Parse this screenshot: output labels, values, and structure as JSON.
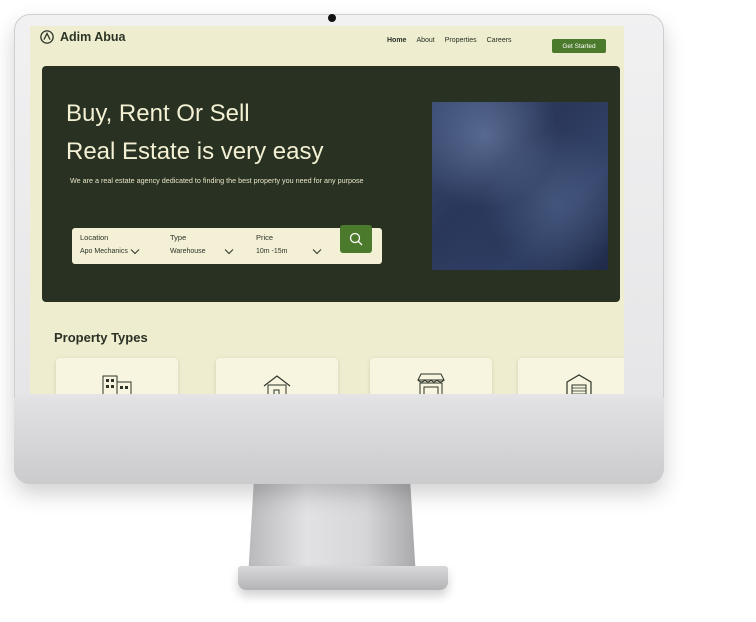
{
  "brand": {
    "name": "Adim Abua"
  },
  "nav": {
    "items": [
      "Home",
      "About",
      "Properties",
      "Careers"
    ],
    "active": "Home",
    "cta_label": "Get Started"
  },
  "hero": {
    "title_line1": "Buy, Rent Or Sell",
    "title_line2": "Real Estate is very easy",
    "subtitle": "We are a real estate agency dedicated to finding the best property you need for any purpose"
  },
  "search": {
    "location": {
      "label": "Location",
      "value": "Apo Mechanics"
    },
    "type": {
      "label": "Type",
      "value": "Warehouse"
    },
    "price": {
      "label": "Price",
      "value": "10m -15m"
    },
    "button_icon": "search-icon"
  },
  "property_types": {
    "title": "Property Types",
    "cards": [
      {
        "icon": "apartment-building-icon"
      },
      {
        "icon": "house-icon"
      },
      {
        "icon": "shop-icon"
      },
      {
        "icon": "warehouse-icon"
      }
    ]
  },
  "colors": {
    "page_bg": "#efedcf",
    "hero_bg": "#283122",
    "accent": "#4c7a2c",
    "hero_text": "#f3f0d3"
  }
}
